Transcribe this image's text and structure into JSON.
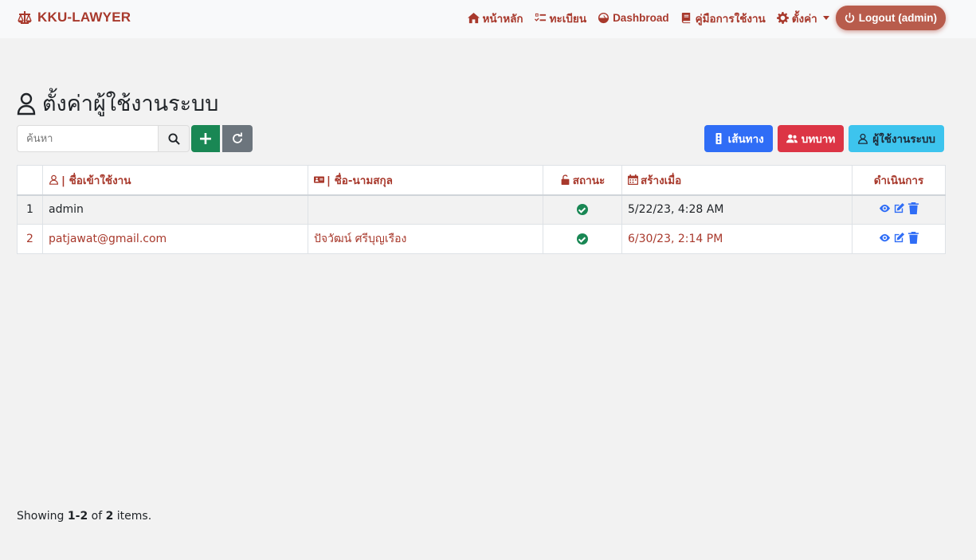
{
  "brand": {
    "name": "KKU-LAWYER"
  },
  "nav": {
    "home": "หน้าหลัก",
    "registry": "ทะเบียน",
    "dashboard": "Dashbroad",
    "manual": "คู่มือการใช้งาน",
    "settings": "ตั้งค่า",
    "logout": "Logout (admin)"
  },
  "page": {
    "title": "ตั้งค่าผู้ใช้งานระบบ"
  },
  "search": {
    "placeholder": "ค้นหา"
  },
  "buttons": {
    "add": "+",
    "routes": "เส้นทาง",
    "roles": "บทบาท",
    "users": "ผู้ใช้งานระบบ"
  },
  "table": {
    "headers": {
      "username": "| ชื่อเข้าใช้งาน",
      "fullname": "| ชื่อ-นามสกุล",
      "status": "สถานะ",
      "created": "สร้างเมื่อ",
      "actions": "ดำเนินการ"
    },
    "rows": [
      {
        "no": "1",
        "username": "admin",
        "fullname": "",
        "status": "active",
        "created": "5/22/23, 4:28 AM"
      },
      {
        "no": "2",
        "username": "patjawat@gmail.com",
        "fullname": "ปัจวัฒน์ ศรีบุญเรือง",
        "status": "active",
        "created": "6/30/23, 2:14 PM"
      }
    ]
  },
  "summary": {
    "prefix": "Showing",
    "range": "1-2",
    "of": "of",
    "total": "2",
    "suffix": "items."
  },
  "colors": {
    "brand": "#a8392c",
    "success": "#198754",
    "primary": "#2f6df6",
    "danger": "#dc3545",
    "info": "#3dc4ee"
  }
}
